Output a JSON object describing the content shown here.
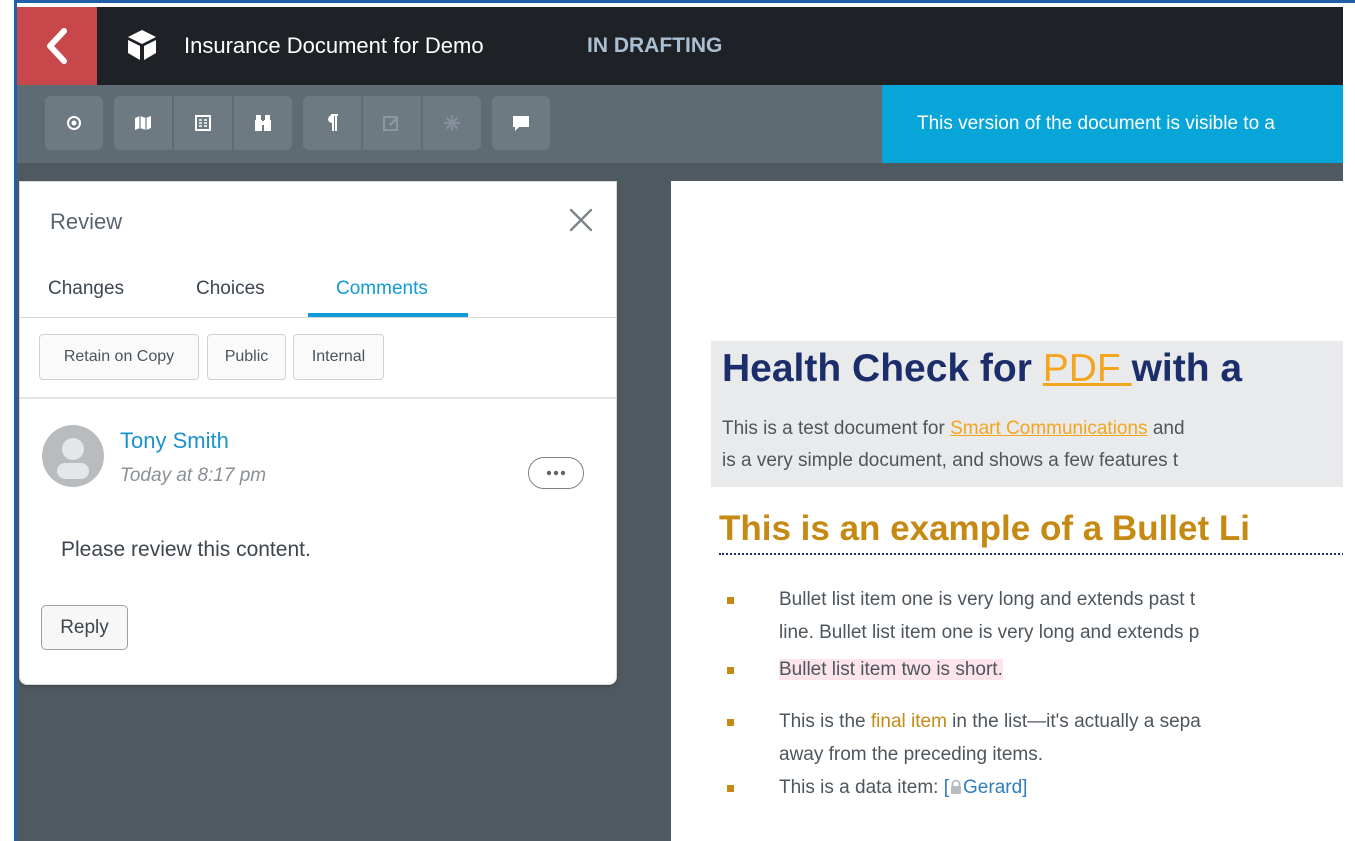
{
  "header": {
    "doc_title": "Insurance Document for Demo",
    "status": "IN DRAFTING"
  },
  "toolbar": {
    "banner_text": "This version of the document is visible to a"
  },
  "review_panel": {
    "title": "Review",
    "tabs": [
      {
        "label": "Changes"
      },
      {
        "label": "Choices"
      },
      {
        "label": "Comments"
      }
    ],
    "active_tab": "Comments",
    "chips": [
      {
        "label": "Retain on Copy"
      },
      {
        "label": "Public"
      },
      {
        "label": "Internal"
      }
    ],
    "comment": {
      "author": "Tony Smith",
      "timestamp": "Today at 8:17 pm",
      "body": "Please review this content.",
      "reply_label": "Reply"
    }
  },
  "document": {
    "heading_pre": "Health Check for ",
    "heading_link": "PDF",
    "heading_post": " with a",
    "intro_line1_pre": "This is a test document for ",
    "intro_line1_link": "Smart Communications",
    "intro_line1_post": " and",
    "intro_line2": "is a very simple document, and shows a few features t",
    "subheading": "This is an example of a Bullet Li",
    "bullets": {
      "item1_line1": "Bullet list item one is very long and extends past t",
      "item1_line2": "line. Bullet list item one is very long and extends p",
      "item2": "Bullet list item two is short.",
      "item3_pre": "This is the ",
      "item3_link": "final item",
      "item3_post": " in the list—it's actually a sepa",
      "item3_line2": "away from the preceding items.",
      "item4_pre": "This is a data item: ",
      "item4_open": "[",
      "item4_value": "Gerard]"
    }
  },
  "colors": {
    "header_bg": "#1e2226",
    "back_button": "#c8474a",
    "toolbar_bg": "#5f6b73",
    "banner_bg": "#08a5d9",
    "accent": "#0e9bd6",
    "heading_navy": "#1b2d6b",
    "heading_gold": "#c58a14",
    "link_orange": "#f3a51e"
  },
  "icons": [
    "chevron-left-icon",
    "cube-icon",
    "eye-icon",
    "map-icon",
    "columns-icon",
    "binoculars-icon",
    "pilcrow-icon",
    "edit-icon",
    "asterisk-icon",
    "comment-icon",
    "close-icon",
    "user-avatar-icon",
    "ellipsis-icon",
    "lock-icon"
  ]
}
